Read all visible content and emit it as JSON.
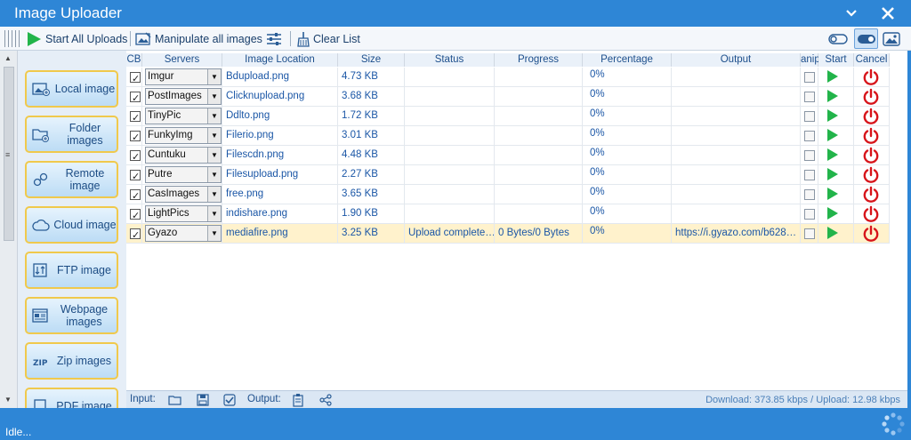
{
  "window": {
    "title": "Image Uploader"
  },
  "toolbar": {
    "start_all": "Start All Uploads",
    "manipulate_all": "Manipulate all images",
    "clear_list": "Clear List"
  },
  "sidebar": {
    "items": [
      {
        "label": "Local image",
        "icon": "local-image-icon"
      },
      {
        "label": "Folder images",
        "icon": "folder-images-icon"
      },
      {
        "label": "Remote image",
        "icon": "remote-image-icon"
      },
      {
        "label": "Cloud image",
        "icon": "cloud-image-icon"
      },
      {
        "label": "FTP image",
        "icon": "ftp-image-icon"
      },
      {
        "label": "Webpage images",
        "icon": "webpage-images-icon"
      },
      {
        "label": "Zip images",
        "icon": "zip-images-icon"
      },
      {
        "label": "PDF image",
        "icon": "pdf-image-icon"
      }
    ]
  },
  "grid": {
    "columns": [
      "CB",
      "Servers",
      "Image Location",
      "Size",
      "Status",
      "Progress",
      "Percentage",
      "Output",
      "anip",
      "Start",
      "Cancel"
    ],
    "rows": [
      {
        "checked": true,
        "server": "Imgur",
        "location": "Bdupload.png",
        "size": "4.73 KB",
        "status": "",
        "progress": "",
        "percentage": "0%",
        "output": "",
        "selected": false
      },
      {
        "checked": true,
        "server": "PostImages",
        "location": "Clicknupload.png",
        "size": "3.68 KB",
        "status": "",
        "progress": "",
        "percentage": "0%",
        "output": "",
        "selected": false
      },
      {
        "checked": true,
        "server": "TinyPic",
        "location": "Ddlto.png",
        "size": "1.72 KB",
        "status": "",
        "progress": "",
        "percentage": "0%",
        "output": "",
        "selected": false
      },
      {
        "checked": true,
        "server": "FunkyImg",
        "location": "Filerio.png",
        "size": "3.01 KB",
        "status": "",
        "progress": "",
        "percentage": "0%",
        "output": "",
        "selected": false
      },
      {
        "checked": true,
        "server": "Cuntuku",
        "location": "Filescdn.png",
        "size": "4.48 KB",
        "status": "",
        "progress": "",
        "percentage": "0%",
        "output": "",
        "selected": false
      },
      {
        "checked": true,
        "server": "Putre",
        "location": "Filesupload.png",
        "size": "2.27 KB",
        "status": "",
        "progress": "",
        "percentage": "0%",
        "output": "",
        "selected": false
      },
      {
        "checked": true,
        "server": "CasImages",
        "location": "free.png",
        "size": "3.65 KB",
        "status": "",
        "progress": "",
        "percentage": "0%",
        "output": "",
        "selected": false
      },
      {
        "checked": true,
        "server": "LightPics",
        "location": "indishare.png",
        "size": "1.90 KB",
        "status": "",
        "progress": "",
        "percentage": "0%",
        "output": "",
        "selected": false
      },
      {
        "checked": true,
        "server": "Gyazo",
        "location": "mediafire.png",
        "size": "3.25 KB",
        "status": "Upload complete…",
        "progress": "0 Bytes/0 Bytes",
        "percentage": "0%",
        "output": "https://i.gyazo.com/b628…",
        "selected": true
      }
    ]
  },
  "bottombar": {
    "input_label": "Input:",
    "output_label": "Output:",
    "speed": "Download: 373.85 kbps / Upload: 12.98 kbps"
  },
  "status": {
    "text": "Idle..."
  },
  "colors": {
    "accent": "#2e86d6",
    "play": "#22b44a",
    "cancel": "#d7141a",
    "highlight": "#f0c94c"
  }
}
